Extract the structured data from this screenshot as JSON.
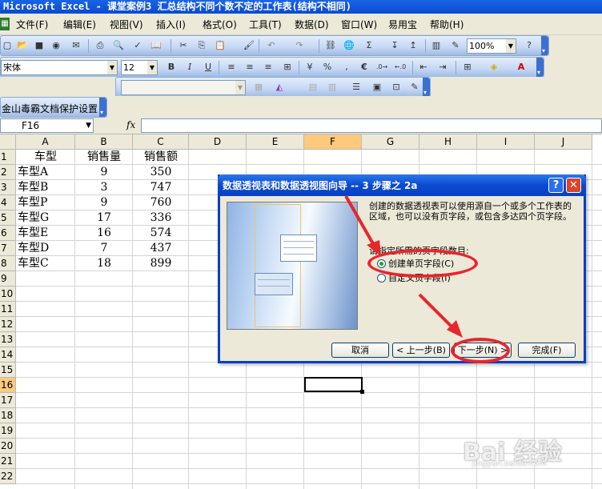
{
  "window": {
    "title": "Microsoft Excel - 课堂案例3  汇总结构不同个数不定的工作表(结构不相同)"
  },
  "menu": {
    "app_icon": "excel-icon",
    "items": [
      "文件(F)",
      "编辑(E)",
      "视图(V)",
      "插入(I)",
      "格式(O)",
      "工具(T)",
      "数据(D)",
      "窗口(W)",
      "易用宝",
      "帮助(H)"
    ]
  },
  "toolbar_standard": {
    "zoom": "100%"
  },
  "toolbar_format": {
    "font_name": "宋体",
    "font_size": "12",
    "bold": "B",
    "italic": "I",
    "underline": "U",
    "percent": "%",
    "comma": ",",
    "euro": "€"
  },
  "toolbar_jinshan": {
    "label": "金山毒霸文档保护设置"
  },
  "formula_bar": {
    "name_box": "F16",
    "fx": "fx",
    "formula": ""
  },
  "sheet": {
    "columns": [
      "A",
      "B",
      "C",
      "D",
      "E",
      "F",
      "G",
      "H",
      "I",
      "J"
    ],
    "active_column": "F",
    "rows": [
      "1",
      "2",
      "3",
      "4",
      "5",
      "6",
      "7",
      "8",
      "9",
      "10",
      "11",
      "12",
      "13",
      "14",
      "15",
      "16",
      "17",
      "18",
      "19",
      "20",
      "21",
      "22"
    ],
    "active_row": "16",
    "headers": [
      "车型",
      "销售量",
      "销售额"
    ],
    "data": [
      [
        "车型A",
        "9",
        "350"
      ],
      [
        "车型B",
        "3",
        "747"
      ],
      [
        "车型P",
        "9",
        "760"
      ],
      [
        "车型G",
        "17",
        "336"
      ],
      [
        "车型E",
        "16",
        "574"
      ],
      [
        "车型D",
        "7",
        "437"
      ],
      [
        "车型C",
        "18",
        "899"
      ]
    ]
  },
  "dialog": {
    "title": "数据透视表和数据透视图向导 -- 3 步骤之 2a",
    "help": "?",
    "close": "✕",
    "description": "创建的数据透视表可以使用源自一个或多个工作表的区域，也可以没有页字段，或包含多达四个页字段。",
    "prompt": "请指定所需的页字段数目:",
    "radio_single": "创建单页字段(C)",
    "radio_custom": "自定义页字段(I)",
    "btn_cancel": "取消",
    "btn_back": "< 上一步(B)",
    "btn_next": "下一步(N) >",
    "btn_finish": "完成(F)"
  },
  "watermark": {
    "text": "Bai 经验",
    "url": "jingyan.baidu.com"
  },
  "colors": {
    "annotation_red": "#e8262c",
    "title_blue": "#0a4ad0",
    "active_header": "#fcc97d"
  }
}
